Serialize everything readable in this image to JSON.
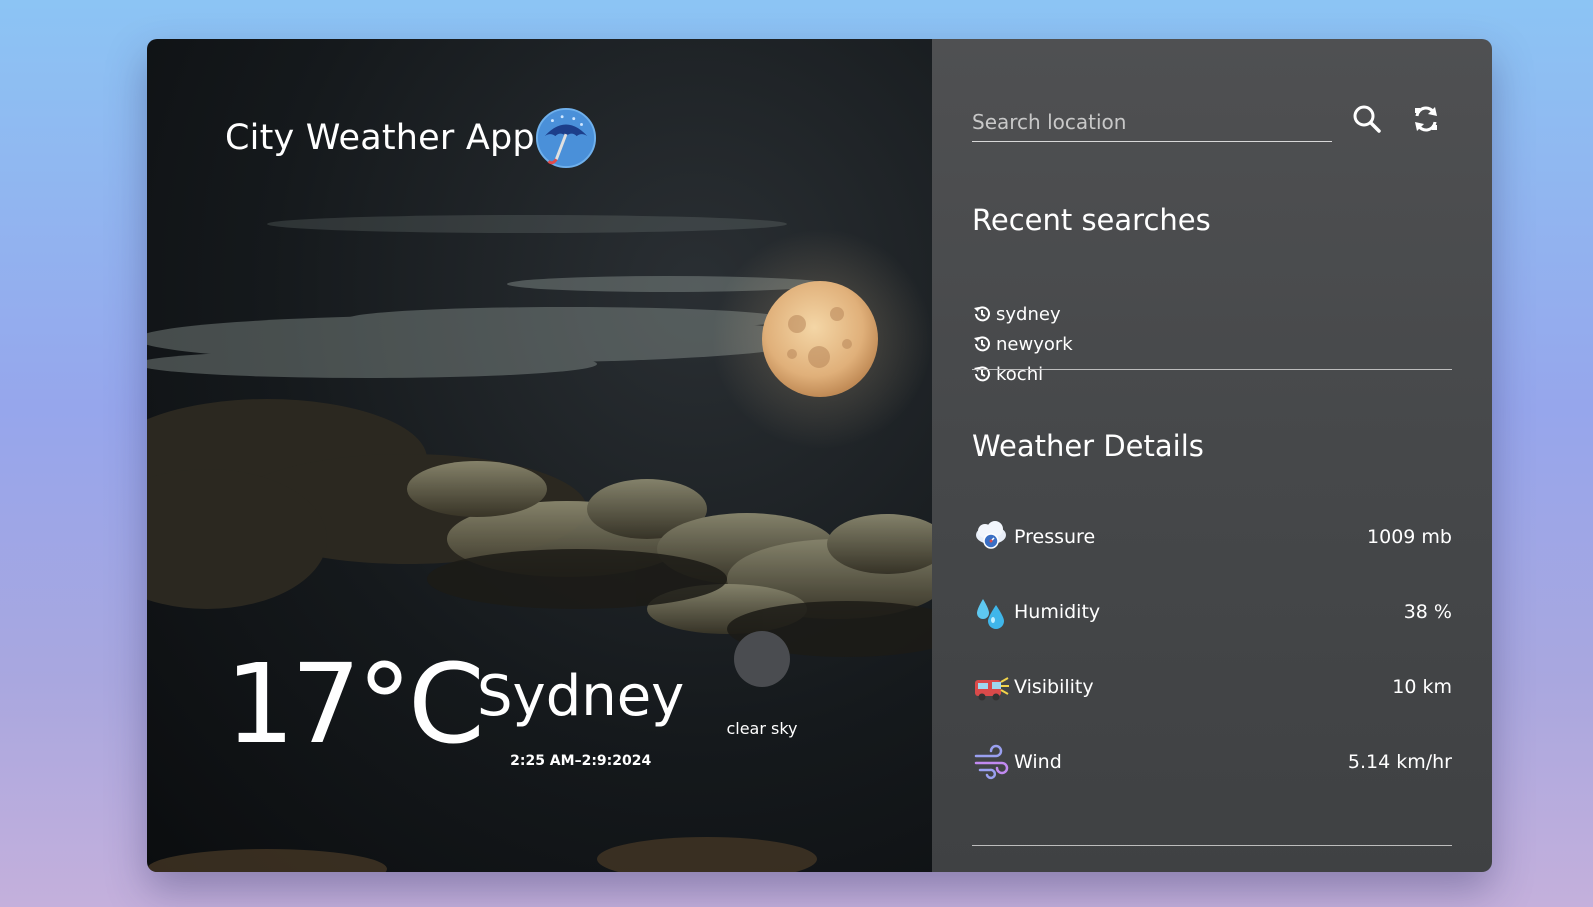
{
  "app": {
    "title": "City Weather App",
    "logo_icon": "umbrella-icon"
  },
  "current": {
    "temperature": "17°C",
    "city": "Sydney",
    "datetime": "2:25 AM–2:9:2024",
    "condition": "clear sky",
    "condition_icon": "weather-condition-icon"
  },
  "search": {
    "placeholder": "Search location",
    "value": "",
    "search_icon": "search-icon",
    "refresh_icon": "refresh-icon"
  },
  "recent": {
    "title": "Recent searches",
    "items": [
      {
        "label": "sydney",
        "icon": "history-icon"
      },
      {
        "label": "newyork",
        "icon": "history-icon"
      },
      {
        "label": "kochi",
        "icon": "history-icon"
      }
    ]
  },
  "details": {
    "title": "Weather Details",
    "rows": [
      {
        "label": "Pressure",
        "value": "1009 mb",
        "icon": "pressure-icon"
      },
      {
        "label": "Humidity",
        "value": "38 %",
        "icon": "humidity-icon"
      },
      {
        "label": "Visibility",
        "value": "10 km",
        "icon": "visibility-icon"
      },
      {
        "label": "Wind",
        "value": "5.14 km/hr",
        "icon": "wind-icon"
      }
    ]
  },
  "colors": {
    "panel_bg": "#4a4b4d",
    "scene_bg": "#15191c",
    "text": "#ffffff",
    "page_gradient_top": "#8cc4f4",
    "page_gradient_bottom": "#c4b0dc"
  }
}
